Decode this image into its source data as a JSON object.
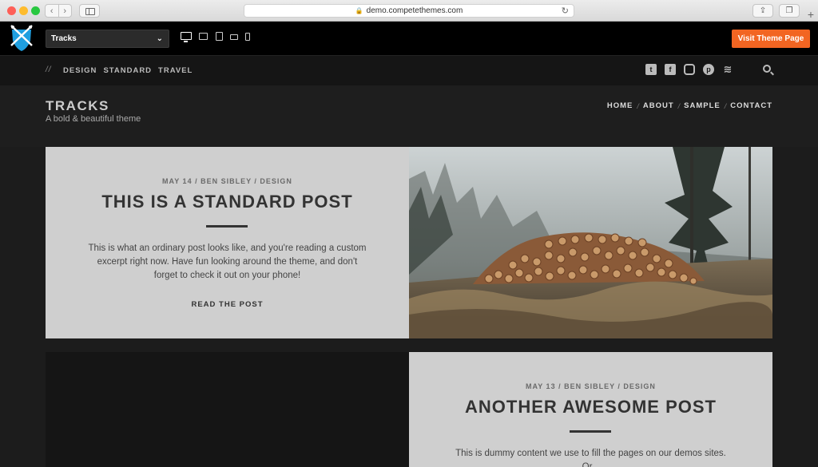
{
  "browser": {
    "url": "demo.competethemes.com",
    "back_icon": "chevron-left-icon",
    "forward_icon": "chevron-right-icon"
  },
  "demo_bar": {
    "theme_selected": "Tracks",
    "visit_button": "Visit Theme Page",
    "accent_color": "#f26522"
  },
  "topnav": {
    "slashes": "//",
    "categories": [
      "DESIGN",
      "STANDARD",
      "TRAVEL"
    ],
    "social_icons": [
      "twitter-icon",
      "facebook-icon",
      "instagram-icon",
      "pinterest-icon",
      "rss-icon"
    ]
  },
  "header": {
    "site_title": "TRACKS",
    "tagline": "A bold & beautiful theme",
    "menu": [
      "HOME",
      "ABOUT",
      "SAMPLE",
      "CONTACT"
    ],
    "menu_separator": "/"
  },
  "posts": [
    {
      "meta": "MAY 14 / BEN SIBLEY / DESIGN",
      "title": "THIS IS A STANDARD POST",
      "excerpt": "This is what an ordinary post looks like, and you're reading a custom excerpt right now. Have fun looking around the theme, and don't forget to check it out on your phone!",
      "read_more": "READ THE POST"
    },
    {
      "meta": "MAY 13 / BEN SIBLEY / DESIGN",
      "title": "ANOTHER AWESOME POST",
      "excerpt": "This is dummy content we use to fill the pages on our demos sites. Or...",
      "read_more": ""
    }
  ]
}
